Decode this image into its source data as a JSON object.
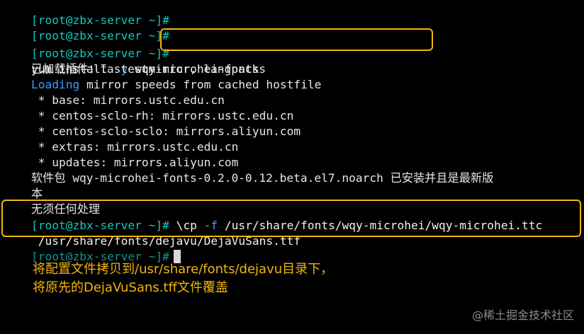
{
  "terminal": {
    "prompt": "[root@zbx-server ~]#",
    "lines": {
      "yum_cmd": "yum install ",
      "yum_flag": "-y",
      "yum_pkg": " wqy-microhei-fonts",
      "plugins": "已加载插件：fastestmirror, langpacks",
      "loading_word": "Loading",
      "loading_rest": " mirror speeds from cached hostfile",
      "mirror_base": " * base: mirrors.ustc.edu.cn",
      "mirror_centos_rh": " * centos-sclo-rh: mirrors.ustc.edu.cn",
      "mirror_centos_sclo": " * centos-sclo-sclo: mirrors.aliyun.com",
      "mirror_extras": " * extras: mirrors.ustc.edu.cn",
      "mirror_updates": " * updates: mirrors.aliyun.com",
      "installed_msg_1": "软件包 wqy-microhei-fonts-0.2.0-0.12.beta.el7.noarch 已安装并且是最新版",
      "installed_msg_2": "本",
      "nothing_to_do": "无须任何处理",
      "cp_cmd_a": " \\cp ",
      "cp_flag": "-f",
      "cp_cmd_b": " /usr/share/fonts/wqy-microhei/wqy-microhei.ttc",
      "cp_cmd_line2": " /usr/share/fonts/dejavu/DejaVuSans.ttf"
    }
  },
  "annotation": {
    "line1": "将配置文件拷贝到/usr/share/fonts/dejavu目录下，",
    "line2": "将原先的DejaVuSans.tff文件覆盖"
  },
  "watermark": "@稀土掘金技术社区",
  "colors": {
    "background": "#000000",
    "prompt": "#16c6c2",
    "flag": "#3aa0ff",
    "highlight": "#f2b60c",
    "text": "#e6e6e6"
  },
  "icons": {
    "cursor": "block-cursor"
  }
}
